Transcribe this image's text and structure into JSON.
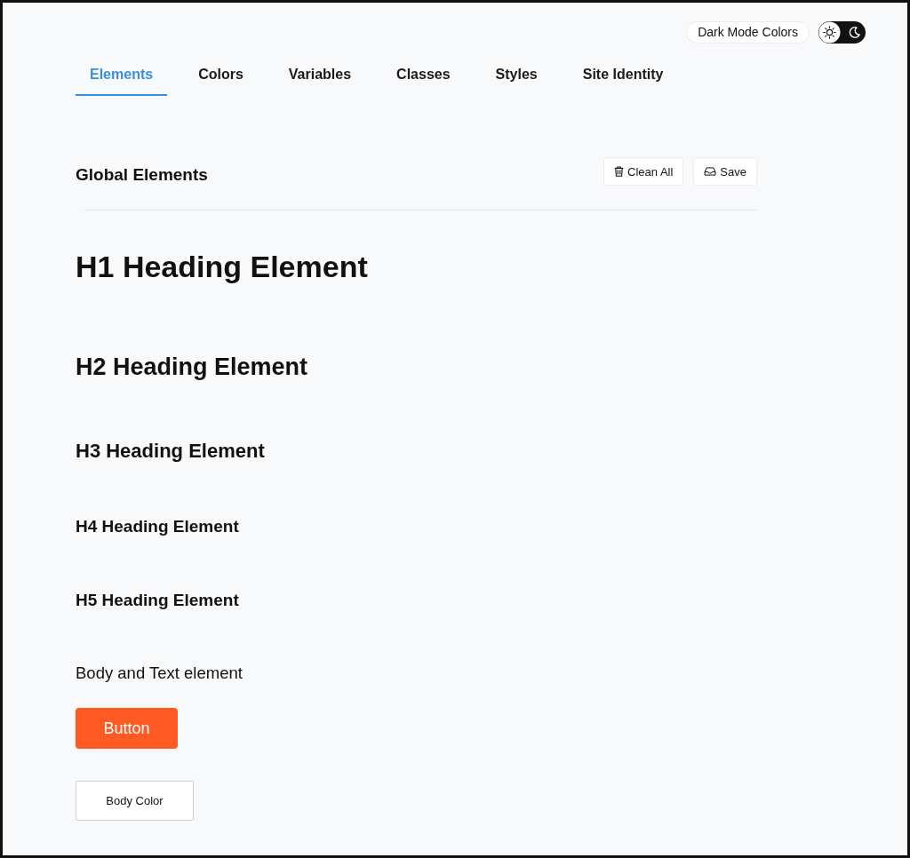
{
  "header": {
    "dark_mode_label": "Dark Mode Colors",
    "dark_mode": false
  },
  "tabs": [
    {
      "label": "Elements",
      "selected": true
    },
    {
      "label": "Colors",
      "selected": false
    },
    {
      "label": "Variables",
      "selected": false
    },
    {
      "label": "Classes",
      "selected": false
    },
    {
      "label": "Styles",
      "selected": false
    },
    {
      "label": "Site Identity",
      "selected": false
    }
  ],
  "section": {
    "title": "Global Elements",
    "actions": [
      {
        "kind": "clean",
        "label": "Clean All"
      },
      {
        "kind": "save",
        "label": "Save"
      }
    ]
  },
  "elements": [
    {
      "kind": "h1",
      "text": "H1 Heading Element"
    },
    {
      "kind": "h2",
      "text": "H2 Heading Element"
    },
    {
      "kind": "h3",
      "text": "H3 Heading Element"
    },
    {
      "kind": "h4",
      "text": "H4 Heading Element"
    },
    {
      "kind": "h5",
      "text": "H5 Heading Element"
    },
    {
      "kind": "body",
      "text": "Body and Text element"
    },
    {
      "kind": "primary_button",
      "text": "Button"
    },
    {
      "kind": "outline_button",
      "text": "Body Color"
    }
  ]
}
